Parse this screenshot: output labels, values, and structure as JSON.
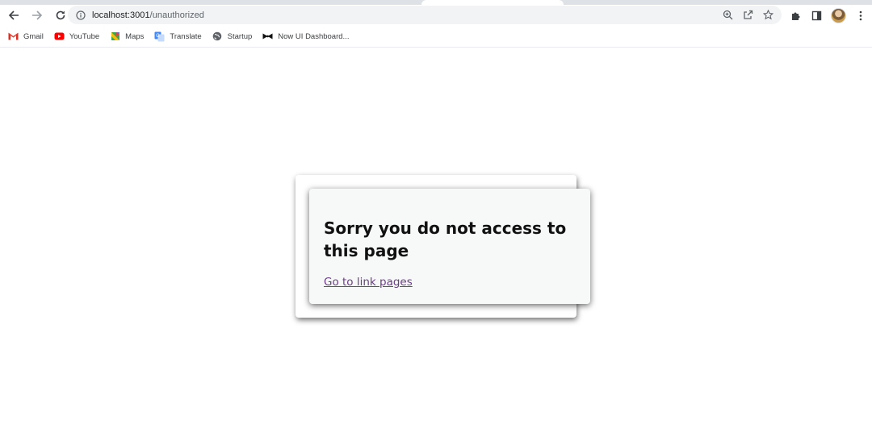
{
  "browser": {
    "url_host": "localhost:3001",
    "url_path": "/unauthorized",
    "icons": {
      "back": "arrow-left-icon",
      "forward": "arrow-right-icon",
      "reload": "reload-icon",
      "site_info": "info-icon",
      "zoom": "zoom-icon",
      "share": "share-icon",
      "bookmark": "star-icon",
      "extensions": "puzzle-icon",
      "side_panel": "side-panel-icon",
      "menu": "kebab-menu-icon"
    }
  },
  "bookmarks": [
    {
      "label": "Gmail",
      "icon": "gmail-icon"
    },
    {
      "label": "YouTube",
      "icon": "youtube-icon"
    },
    {
      "label": "Maps",
      "icon": "maps-icon"
    },
    {
      "label": "Translate",
      "icon": "translate-icon"
    },
    {
      "label": "Startup",
      "icon": "globe-icon"
    },
    {
      "label": "Now UI Dashboard...",
      "icon": "bowtie-icon"
    }
  ],
  "page": {
    "heading": "Sorry you do not access to this page",
    "link_text": "Go to link pages"
  },
  "colors": {
    "card_background": "#f6f9f8",
    "link": "#6c3d84",
    "omnibox_background": "#f1f3f4"
  }
}
